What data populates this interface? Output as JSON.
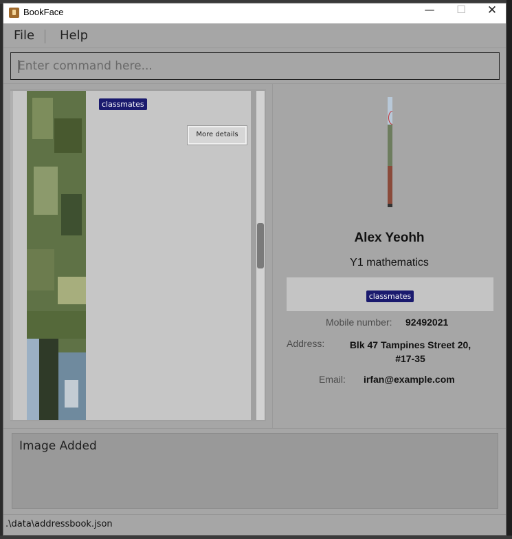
{
  "window": {
    "title": "BookFace",
    "controls": {
      "minimize": "—",
      "maximize": "☐",
      "close": "✕"
    }
  },
  "menu": {
    "items": [
      {
        "label": "File"
      },
      {
        "label": "Help"
      }
    ]
  },
  "command": {
    "placeholder": "Enter command here...",
    "value": ""
  },
  "person_list": {
    "cards": [
      {
        "tags": [
          "classmates"
        ],
        "details_button": "More details"
      }
    ]
  },
  "person_detail": {
    "name": "Alex Yeohh",
    "subtitle": "Y1 mathematics",
    "tags": [
      "classmates"
    ],
    "mobile_label": "Mobile number:",
    "mobile_value": "92492021",
    "address_label": "Address:",
    "address_value": "Blk 47 Tampines Street 20, #17-35",
    "email_label": "Email:",
    "email_value": "irfan@example.com"
  },
  "result": {
    "message": "Image Added"
  },
  "status": {
    "file_path": ".\\data\\addressbook.json"
  },
  "colors": {
    "window_bg": "#a6a6a6",
    "card_bg": "#c6c6c6",
    "tag_bg": "#1a1a6e",
    "result_bg": "#999999"
  }
}
